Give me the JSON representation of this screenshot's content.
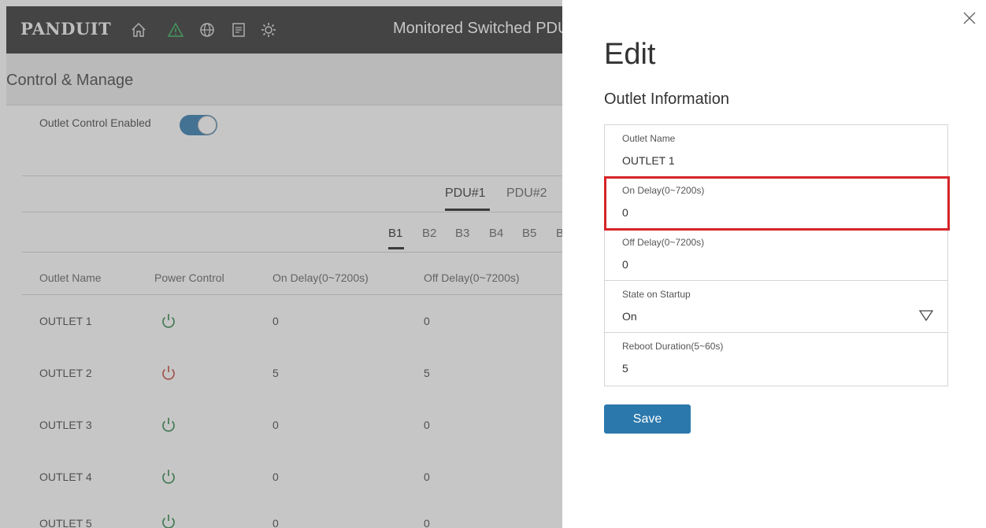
{
  "app": {
    "logo": "PANDUIT",
    "title": "Monitored Switched PDU",
    "nav_icons": [
      "home-icon",
      "alert-icon",
      "globe-icon",
      "document-icon",
      "settings-icon"
    ],
    "accent_color": "#1f6fa8",
    "alert_color": "#22b14c"
  },
  "page": {
    "title": "Control & Manage",
    "outlet_control_label": "Outlet Control Enabled",
    "outlet_control_enabled": true
  },
  "pdu_tabs": [
    "PDU#1",
    "PDU#2"
  ],
  "bank_tabs": [
    "B1",
    "B2",
    "B3",
    "B4",
    "B5",
    "B"
  ],
  "table": {
    "headers": [
      "Outlet Name",
      "Power Control",
      "On Delay(0~7200s)",
      "Off Delay(0~7200s)"
    ],
    "rows": [
      {
        "name": "OUTLET 1",
        "state": "on",
        "on_delay": "0",
        "off_delay": "0"
      },
      {
        "name": "OUTLET 2",
        "state": "off",
        "on_delay": "5",
        "off_delay": "5"
      },
      {
        "name": "OUTLET 3",
        "state": "on",
        "on_delay": "0",
        "off_delay": "0"
      },
      {
        "name": "OUTLET 4",
        "state": "on",
        "on_delay": "0",
        "off_delay": "0"
      },
      {
        "name": "OUTLET 5",
        "state": "on",
        "on_delay": "0",
        "off_delay": "0"
      }
    ],
    "on_color": "#1f7a3a",
    "off_color": "#c0392b"
  },
  "edit_panel": {
    "title": "Edit",
    "section": "Outlet Information",
    "fields": [
      {
        "label": "Outlet Name",
        "value": "OUTLET 1"
      },
      {
        "label": "On Delay(0~7200s)",
        "value": "0"
      },
      {
        "label": "Off Delay(0~7200s)",
        "value": "0"
      },
      {
        "label": "State on Startup",
        "value": "On"
      },
      {
        "label": "Reboot Duration(5~60s)",
        "value": "5"
      }
    ],
    "save_label": "Save",
    "highlight_color": "#d52428"
  }
}
